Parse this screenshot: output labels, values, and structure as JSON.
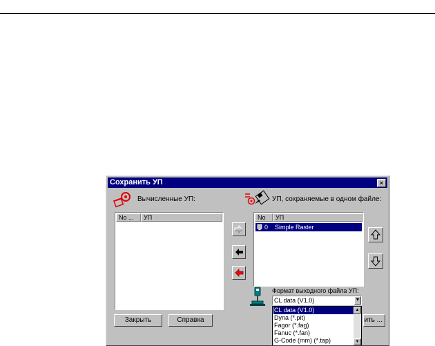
{
  "dialog": {
    "title": "Сохранить УП",
    "close_glyph": "×"
  },
  "left_panel": {
    "label": "Вычисленные УП:",
    "icon": "computed-toolpaths-icon",
    "columns": [
      "No ...",
      "УП"
    ],
    "rows": []
  },
  "right_panel": {
    "label": "УП, сохраняемые в одном файле:",
    "icon": "save-file-icon",
    "columns": [
      "No ...",
      "УП"
    ],
    "rows": [
      {
        "no": "0",
        "name": "Simple Raster",
        "selected": true
      }
    ]
  },
  "transfer_buttons": {
    "add": "arrow-right-icon",
    "remove": "arrow-left-black-icon",
    "remove_all": "arrow-left-red-icon"
  },
  "order_buttons": {
    "up": "arrow-up-icon",
    "down": "arrow-down-icon"
  },
  "format": {
    "label": "Формат выходного файла УП:",
    "icon": "postprocessor-icon",
    "selected": "CL data (V1.0)",
    "options": [
      "CL data (V1.0)",
      "Dyna (*.pit)",
      "Fagor (*.fag)",
      "Fanuc (*.fan)",
      "G-Code (mm) (*.tap)"
    ]
  },
  "buttons": {
    "close": "Закрыть",
    "help": "Справка",
    "save_partial": "ить ..."
  },
  "colors": {
    "title_bar": "#000080",
    "dialog_bg": "#c0c0c0",
    "selection": "#000080",
    "red_arrow": "#ff0000"
  }
}
